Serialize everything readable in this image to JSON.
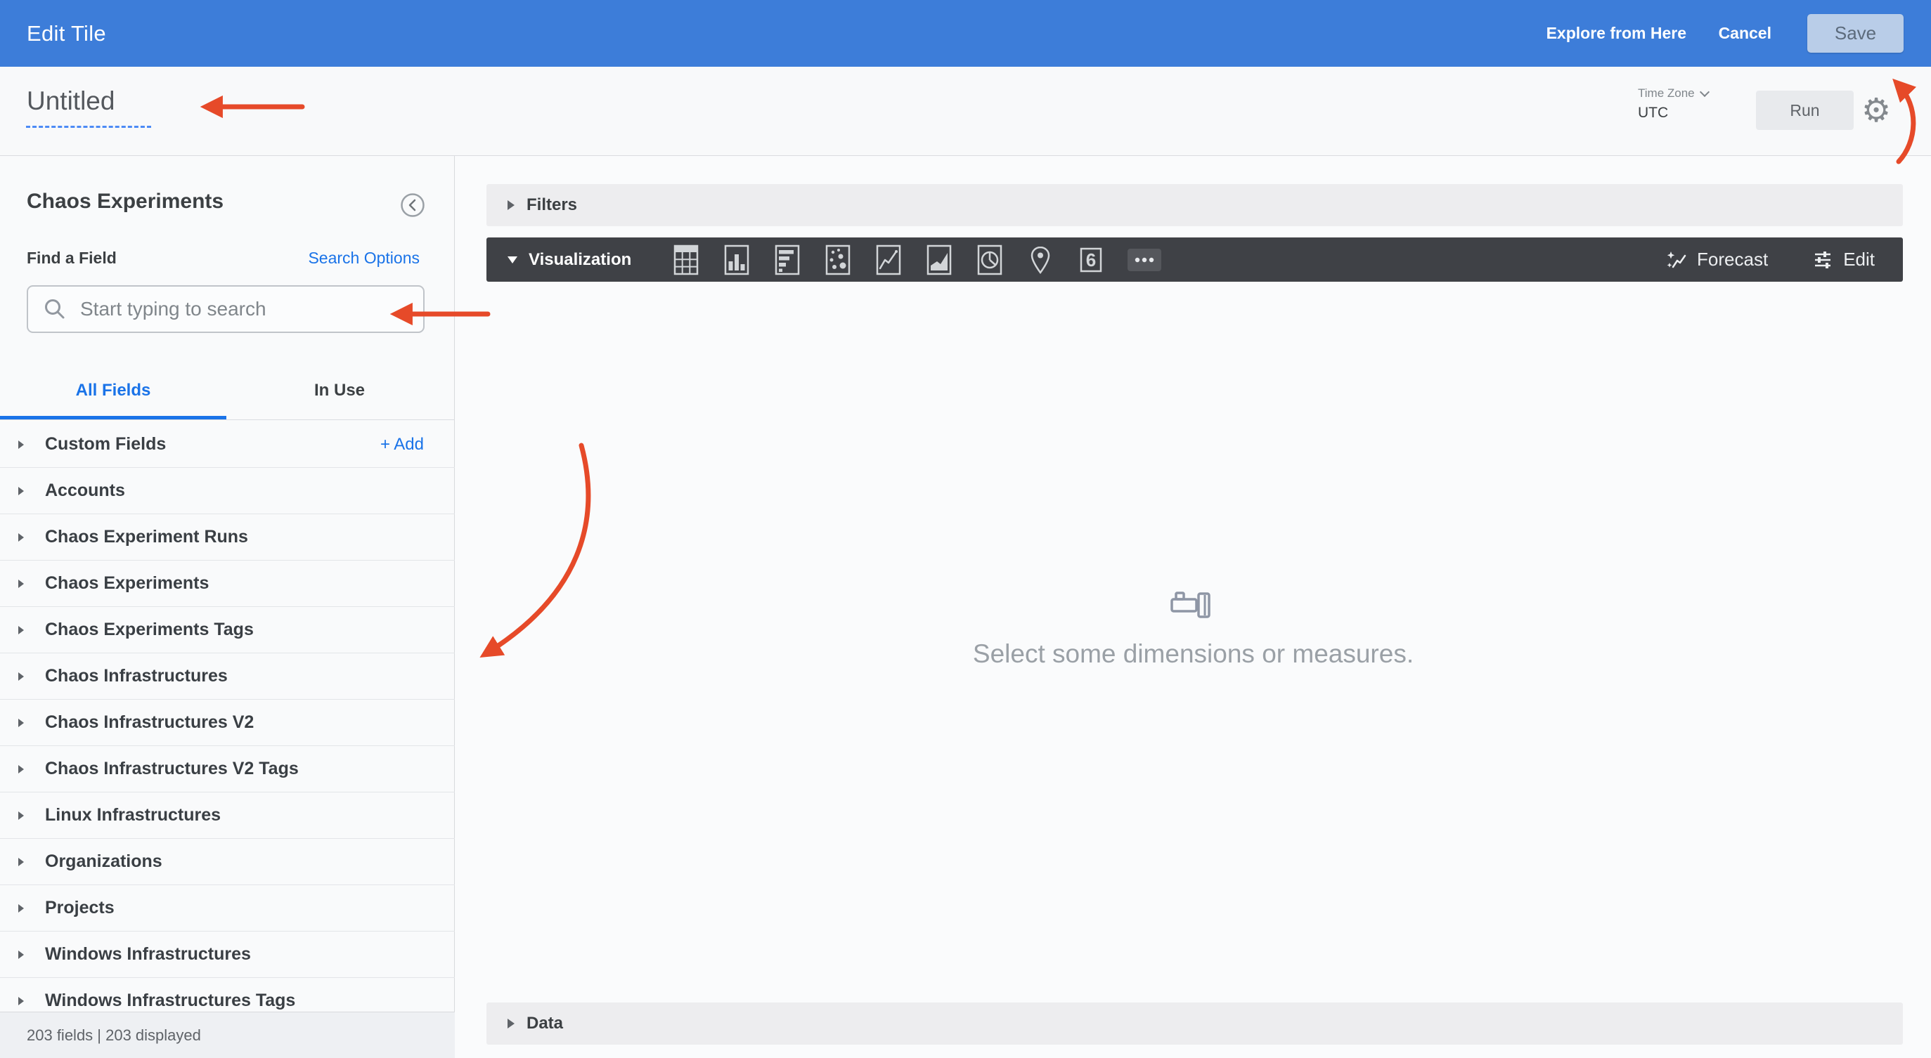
{
  "top_bar": {
    "title": "Edit Tile",
    "explore_label": "Explore from Here",
    "cancel_label": "Cancel",
    "save_label": "Save"
  },
  "header": {
    "tile_title": "Untitled",
    "time_zone_label": "Time Zone",
    "time_zone_value": "UTC",
    "run_label": "Run"
  },
  "sidebar": {
    "explore_title": "Chaos Experiments",
    "find_a_field_label": "Find a Field",
    "search_options_label": "Search Options",
    "search_placeholder": "Start typing to search",
    "search_value": "",
    "tabs": [
      {
        "label": "All Fields",
        "active": true
      },
      {
        "label": "In Use",
        "active": false
      }
    ],
    "custom_fields_label": "Custom Fields",
    "add_label": "+ Add",
    "field_groups": [
      "Accounts",
      "Chaos Experiment Runs",
      "Chaos Experiments",
      "Chaos Experiments Tags",
      "Chaos Infrastructures",
      "Chaos Infrastructures V2",
      "Chaos Infrastructures V2 Tags",
      "Linux Infrastructures",
      "Organizations",
      "Projects",
      "Windows Infrastructures",
      "Windows Infrastructures Tags"
    ],
    "status_text": "203 fields | 203 displayed"
  },
  "main": {
    "filters_label": "Filters",
    "visualization_label": "Visualization",
    "viz": {
      "icon_names": [
        "table-icon",
        "column-chart-icon",
        "bar-chart-icon",
        "scatter-chart-icon",
        "line-chart-icon",
        "area-chart-icon",
        "pie-chart-icon",
        "map-chart-icon",
        "single-value-icon",
        "more-viz-icon"
      ],
      "single_value_glyph": "6",
      "forecast_label": "Forecast",
      "edit_label": "Edit"
    },
    "empty_state_text": "Select some dimensions or measures.",
    "data_label": "Data"
  },
  "annotations": {
    "color": "#e64a29",
    "arrows": [
      "tile-title-arrow",
      "search-field-arrow",
      "field-list-arrow",
      "save-button-arrow"
    ]
  },
  "colors": {
    "top_bar": "#3d7dd9",
    "link_blue": "#1a73e8",
    "viz_bar": "#3f4146",
    "annotation_red": "#e64a29"
  }
}
